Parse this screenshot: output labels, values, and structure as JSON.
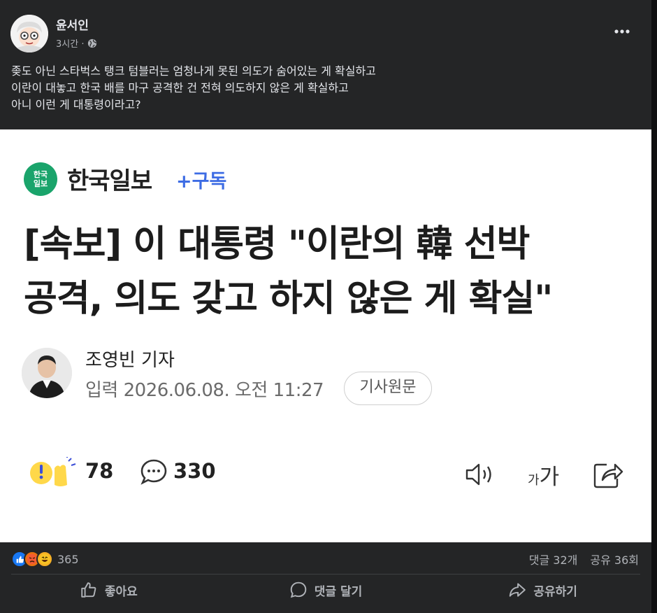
{
  "post": {
    "author": "윤서인",
    "time": "3시간 ·",
    "lines": [
      "좆도 아닌 스타벅스 탱크 텀블러는 엄청나게 못된 의도가 숨어있는 게 확실하고",
      "이란이 대놓고 한국 배를 마구 공격한 건 전혀 의도하지 않은 게 확실하고",
      "아니 이런 게 대통령이라고?"
    ]
  },
  "article": {
    "press_logo": "한국\n일보",
    "press_name": "한국일보",
    "subscribe_label": "+구독",
    "headline_line1": "[속보] 이 대통령 \"이란의 韓 선박",
    "headline_line2": "공격, 의도 갖고 하지 않은 게 확실\"",
    "reporter": "조영빈 기자",
    "input_date": "입력 2026.06.08. 오전 11:27",
    "original_label": "기사원문",
    "like_count": "78",
    "comment_count": "330",
    "fontsize_small": "가",
    "fontsize_big": "가"
  },
  "footer": {
    "reaction_count": "365",
    "comments": "댓글 32개",
    "shares": "공유 36회",
    "like_label": "좋아요",
    "comment_label": "댓글 달기",
    "share_label": "공유하기"
  },
  "colors": {
    "background": "#242526",
    "text": "#e4e6eb",
    "muted": "#b0b3b8",
    "press_green": "#1aa46b",
    "subscribe_blue": "#3d6ce4",
    "like_blue": "#1877f2",
    "angry_red": "#e9710f",
    "haha_yellow": "#f7b125"
  },
  "icons": [
    "globe-icon",
    "more-icon",
    "clap-icon",
    "comment-bubble-icon",
    "speaker-icon",
    "share-arrow-icon",
    "like-reaction-icon",
    "angry-reaction-icon",
    "haha-reaction-icon",
    "thumbs-up-icon",
    "comment-icon",
    "share-icon"
  ]
}
